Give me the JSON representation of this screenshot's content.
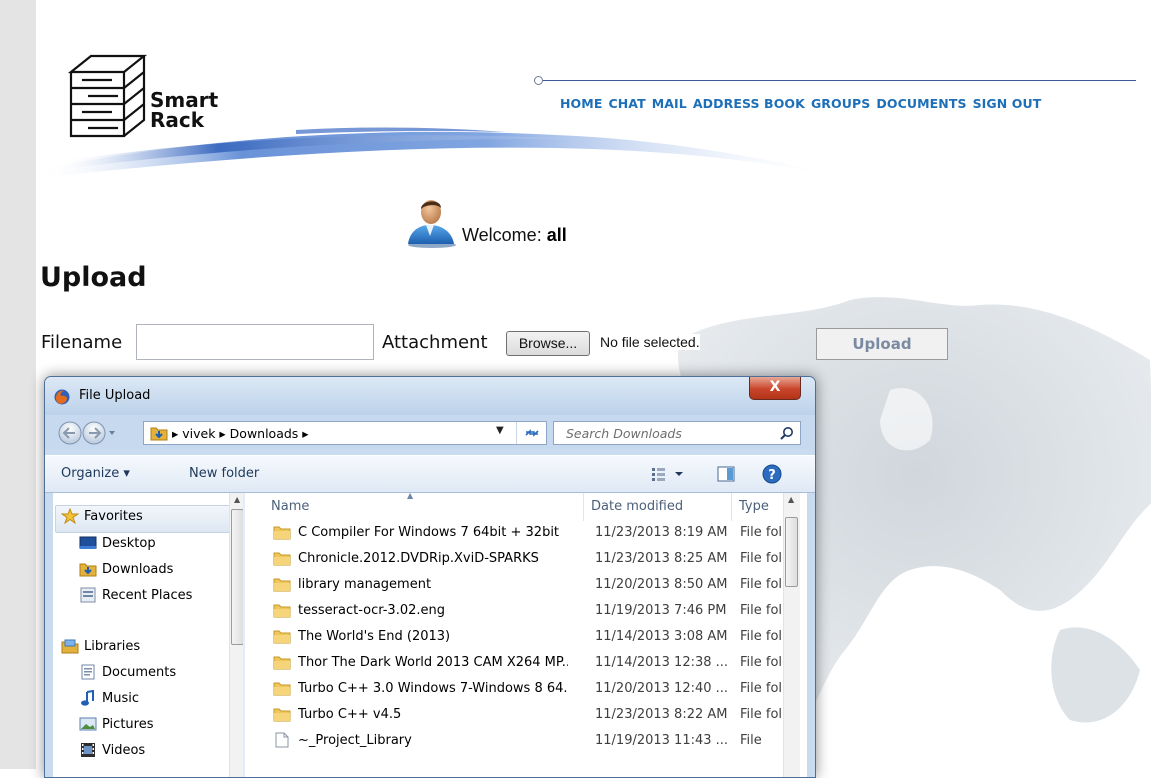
{
  "logo": {
    "line1": "Smart",
    "line2": "Rack"
  },
  "nav": [
    "HOME",
    "CHAT",
    "MAIL",
    "ADDRESS BOOK",
    "GROUPS",
    "DOCUMENTS",
    "SIGN OUT"
  ],
  "welcome": {
    "label": "Welcome:",
    "user": "all"
  },
  "page": {
    "heading": "Upload",
    "filename_label": "Filename",
    "attachment_label": "Attachment",
    "browse_label": "Browse...",
    "no_file": "No file selected.",
    "upload_label": "Upload"
  },
  "dialog": {
    "title": "File Upload",
    "close_label": "X",
    "breadcrumb": "▸ vivek ▸ Downloads ▸",
    "search_placeholder": "Search Downloads",
    "organize": "Organize ▾",
    "new_folder": "New folder",
    "sidebar": {
      "favorites": "Favorites",
      "desktop": "Desktop",
      "downloads": "Downloads",
      "recent": "Recent Places",
      "libraries": "Libraries",
      "documents": "Documents",
      "music": "Music",
      "pictures": "Pictures",
      "videos": "Videos"
    },
    "columns": {
      "name": "Name",
      "date": "Date modified",
      "type": "Type"
    },
    "files": [
      {
        "name": "C Compiler For Windows 7 64bit + 32bit",
        "date": "11/23/2013 8:19 AM",
        "type": "File fol",
        "kind": "folder"
      },
      {
        "name": "Chronicle.2012.DVDRip.XviD-SPARKS",
        "date": "11/23/2013 8:25 AM",
        "type": "File fol",
        "kind": "folder"
      },
      {
        "name": "library management",
        "date": "11/20/2013 8:50 AM",
        "type": "File fol",
        "kind": "folder"
      },
      {
        "name": "tesseract-ocr-3.02.eng",
        "date": "11/19/2013 7:46 PM",
        "type": "File fol",
        "kind": "folder"
      },
      {
        "name": "The World's End (2013)",
        "date": "11/14/2013 3:08 AM",
        "type": "File fol",
        "kind": "folder"
      },
      {
        "name": "Thor The Dark World 2013 CAM X264 MP...",
        "date": "11/14/2013 12:38 ...",
        "type": "File fol",
        "kind": "folder"
      },
      {
        "name": "Turbo C++ 3.0 Windows 7-Windows 8 64...",
        "date": "11/20/2013 12:40 ...",
        "type": "File fol",
        "kind": "folder"
      },
      {
        "name": "Turbo C++ v4.5",
        "date": "11/23/2013 8:22 AM",
        "type": "File fol",
        "kind": "folder"
      },
      {
        "name": "~_Project_Library",
        "date": "11/19/2013 11:43 ...",
        "type": "File",
        "kind": "file"
      }
    ]
  },
  "colors": {
    "nav_link": "#1d6fb8",
    "dialog_frame": "#c9dbef",
    "close_button": "#c9452a"
  }
}
